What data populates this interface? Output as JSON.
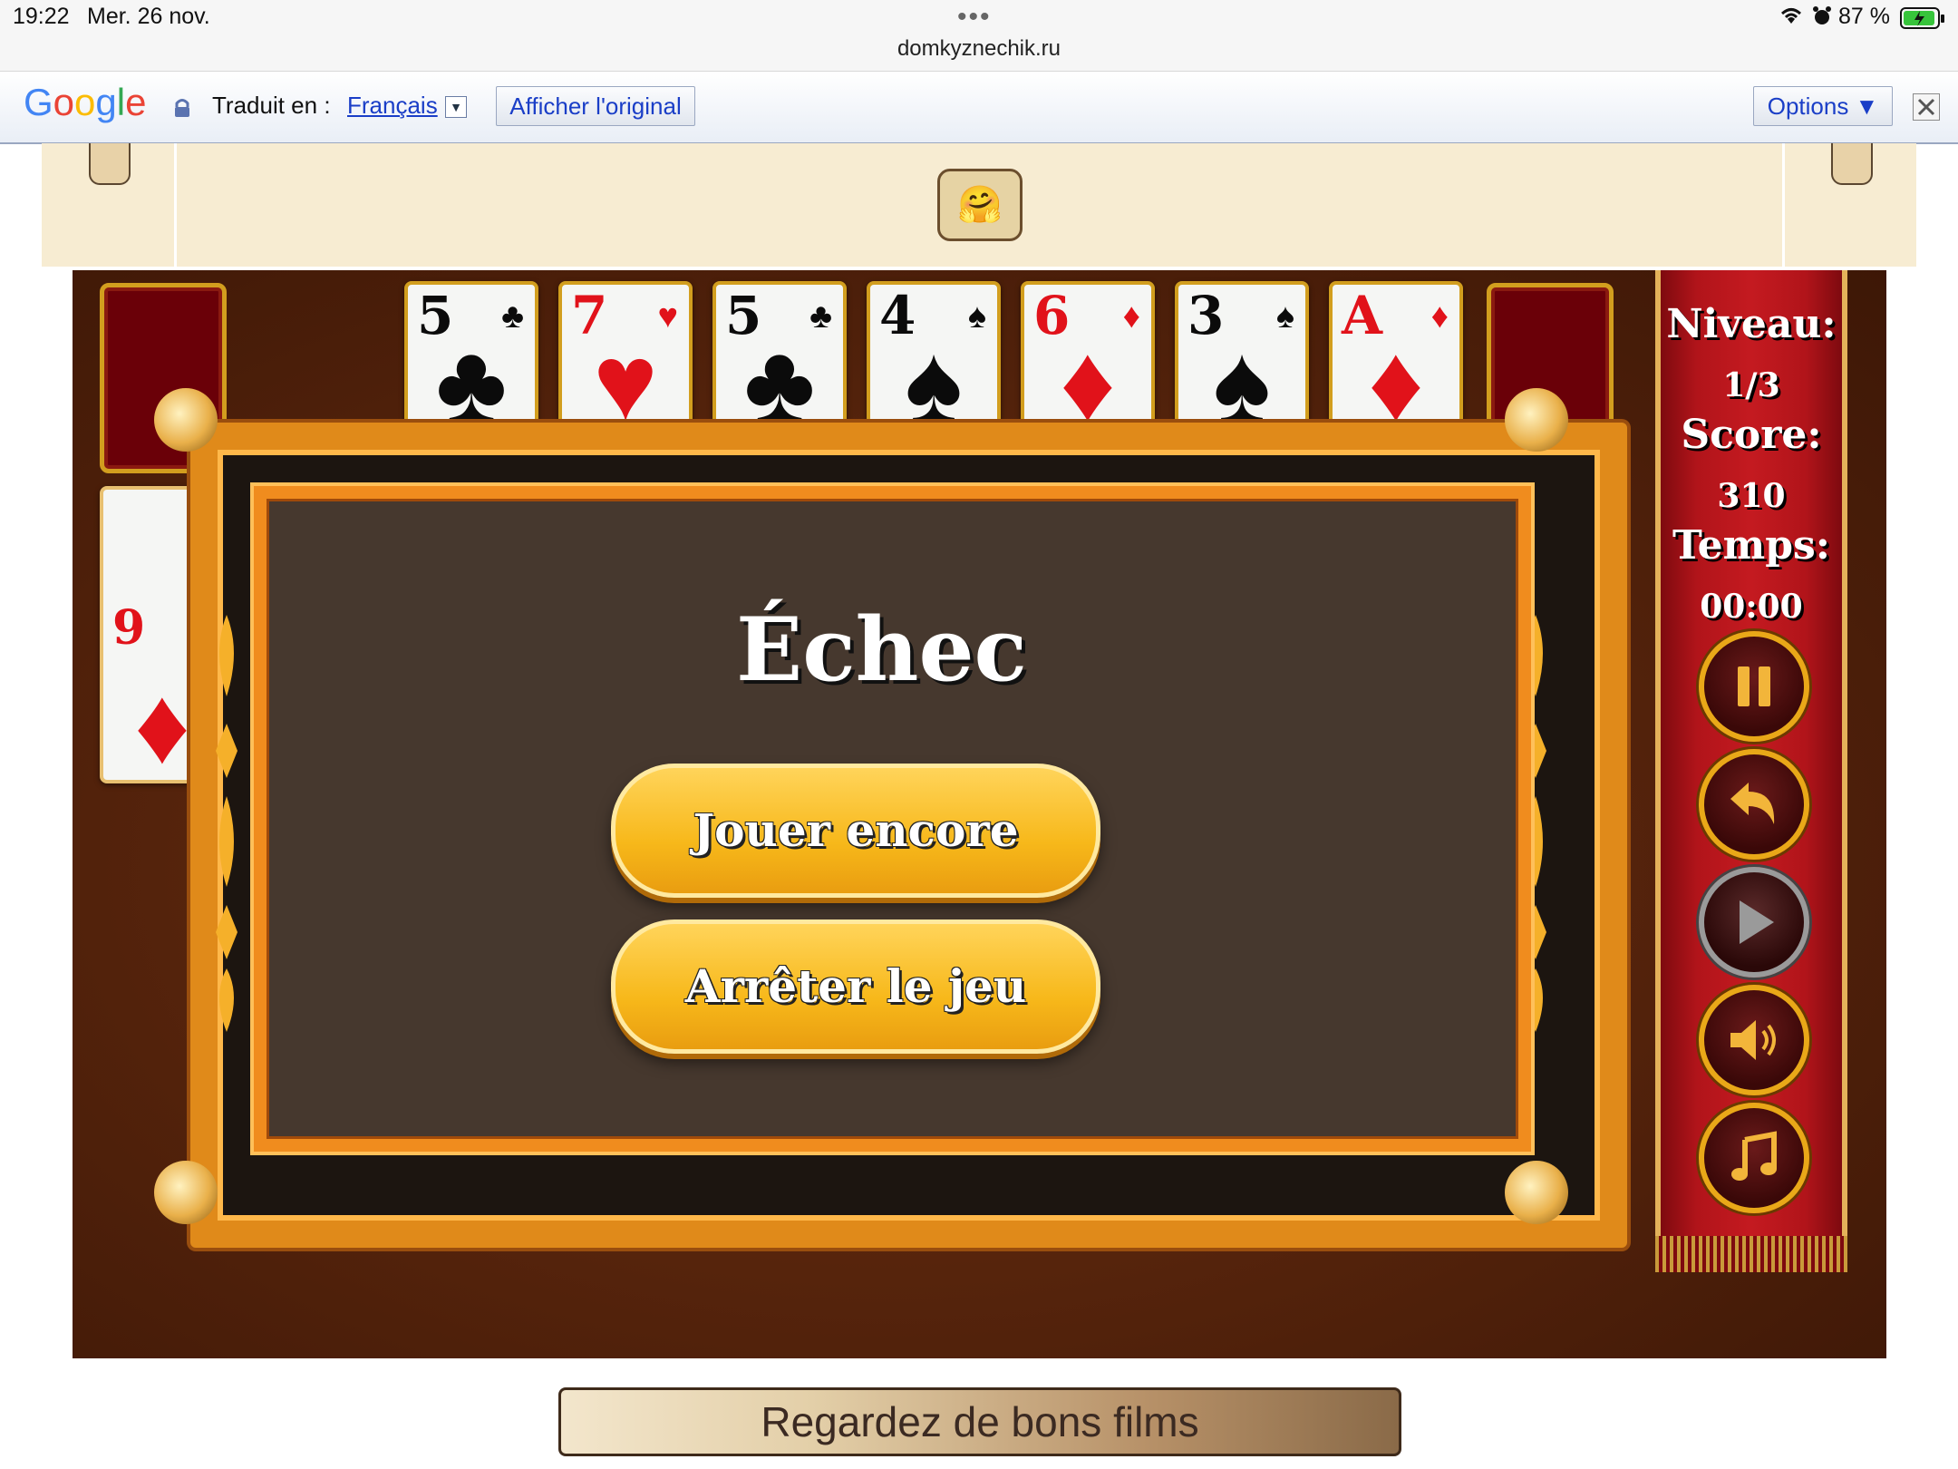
{
  "status_bar": {
    "time": "19:22",
    "date": "Mer. 26 nov.",
    "url": "domkyznechik.ru",
    "battery": "87 %"
  },
  "translate_bar": {
    "translated_label": "Traduit en :",
    "language": "Français",
    "show_original": "Afficher l'original",
    "options": "Options ▼"
  },
  "game": {
    "foundation_cards": [
      {
        "rank": "5",
        "suit": "♣",
        "color": "black"
      },
      {
        "rank": "7",
        "suit": "♥",
        "color": "red"
      },
      {
        "rank": "5",
        "suit": "♣",
        "color": "black"
      },
      {
        "rank": "4",
        "suit": "♠",
        "color": "black"
      },
      {
        "rank": "6",
        "suit": "♦",
        "color": "red"
      },
      {
        "rank": "3",
        "suit": "♠",
        "color": "black"
      },
      {
        "rank": "A",
        "suit": "♦",
        "color": "red"
      }
    ],
    "left_card": {
      "rank": "9",
      "suit": "♦"
    },
    "panel": {
      "level_label": "Niveau:",
      "level_value": "1/3",
      "score_label": "Score:",
      "score_value": "310",
      "time_label": "Temps:",
      "time_value": "00:00"
    },
    "dialog": {
      "title": "Échec",
      "play_again": "Jouer encore",
      "stop_game": "Arrêter le jeu"
    }
  },
  "footer": {
    "banner": "Regardez de bons films"
  },
  "colors": {
    "accent_gold": "#f7b81a",
    "panel_red": "#b1141a",
    "link_blue": "#1a3ec7"
  }
}
